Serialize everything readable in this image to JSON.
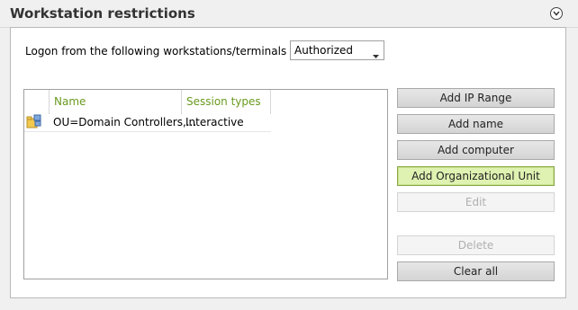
{
  "section": {
    "title": "Workstation restrictions",
    "collapse_icon": "chevron-down-circle-icon"
  },
  "logon": {
    "label": "Logon from the following workstations/terminals are",
    "selected": "Authorized"
  },
  "list": {
    "columns": [
      "Name",
      "Session types"
    ],
    "rows": [
      {
        "icon": "organizational-unit-icon",
        "name": "OU=Domain Controllers,...",
        "session_types": "Interactive"
      }
    ]
  },
  "buttons": {
    "add_ip_range": "Add IP Range",
    "add_name": "Add name",
    "add_computer": "Add computer",
    "add_ou": "Add Organizational Unit",
    "edit": "Edit",
    "delete": "Delete",
    "clear_all": "Clear all"
  },
  "colors": {
    "header_text": "#6a9a1f",
    "highlight_bg": "#dff2b1",
    "disabled_text": "#b0b0b0"
  }
}
